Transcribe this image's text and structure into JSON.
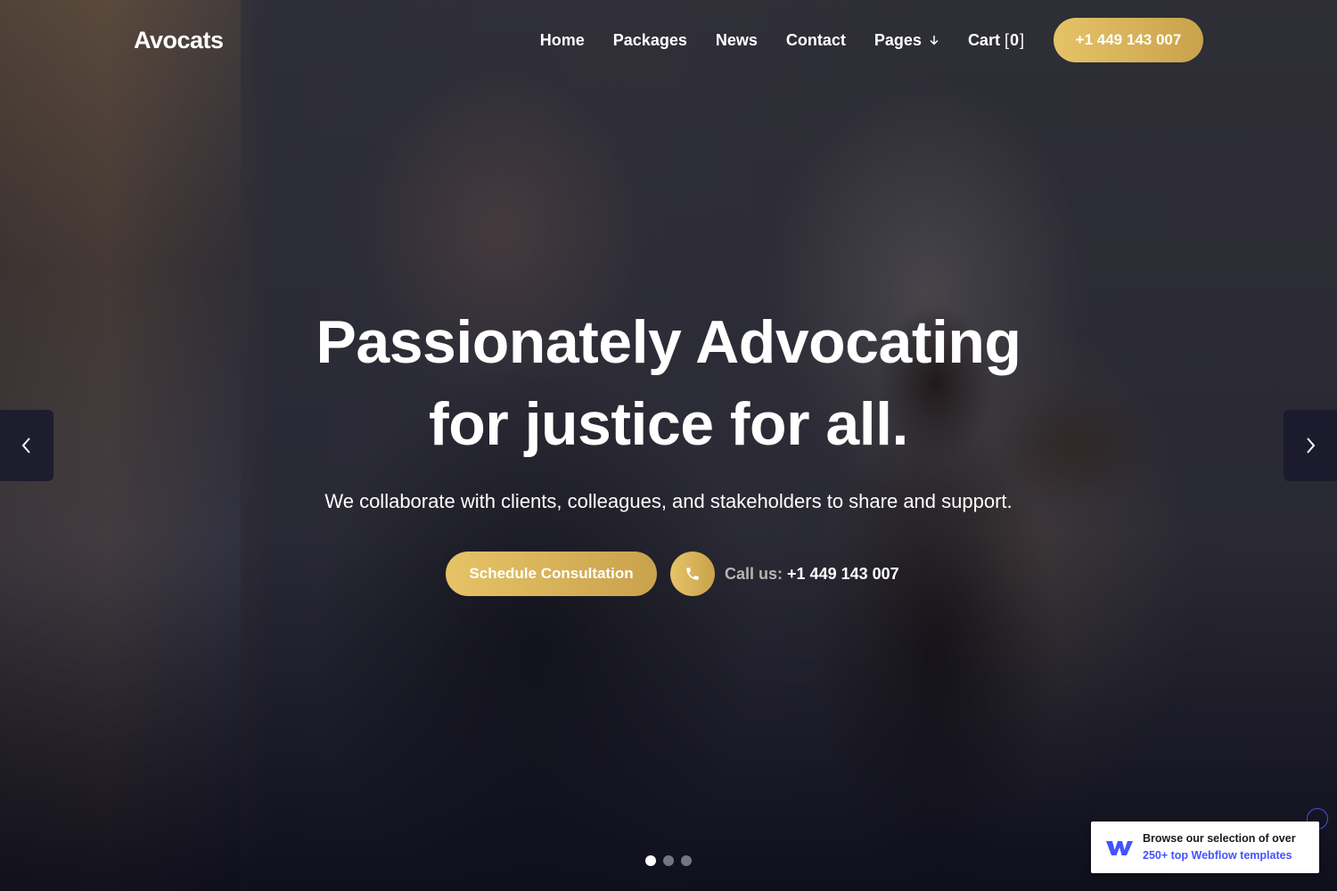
{
  "brand": {
    "logo": "Avocats"
  },
  "nav": {
    "links": [
      {
        "label": "Home"
      },
      {
        "label": "Packages"
      },
      {
        "label": "News"
      },
      {
        "label": "Contact"
      },
      {
        "label": "Pages"
      }
    ],
    "cart_label": "Cart",
    "cart_count": "0",
    "phone_button": "+1 449 143 007"
  },
  "hero": {
    "title_line1": "Passionately Advocating",
    "title_line2": "for justice for all.",
    "subtitle": "We collaborate with clients, colleagues, and stakeholders to share and support.",
    "cta_label": "Schedule Consultation",
    "call_label": "Call us:",
    "call_number": "+1 449 143 007"
  },
  "slider": {
    "slide_count": 3,
    "active_slide": 1
  },
  "badge": {
    "line1": "Browse our selection of over",
    "line2": "250+ top Webflow templates"
  },
  "colors": {
    "accent_gold_light": "#e6c367",
    "accent_gold_dark": "#c9a24c",
    "webflow_blue": "#4353ff",
    "arrow_bg": "#19192d"
  },
  "icons": {
    "pages_dropdown": "chevron-down-icon",
    "call": "phone-icon",
    "prev": "chevron-left-icon",
    "next": "chevron-right-icon",
    "badge": "webflow-logo-icon"
  }
}
